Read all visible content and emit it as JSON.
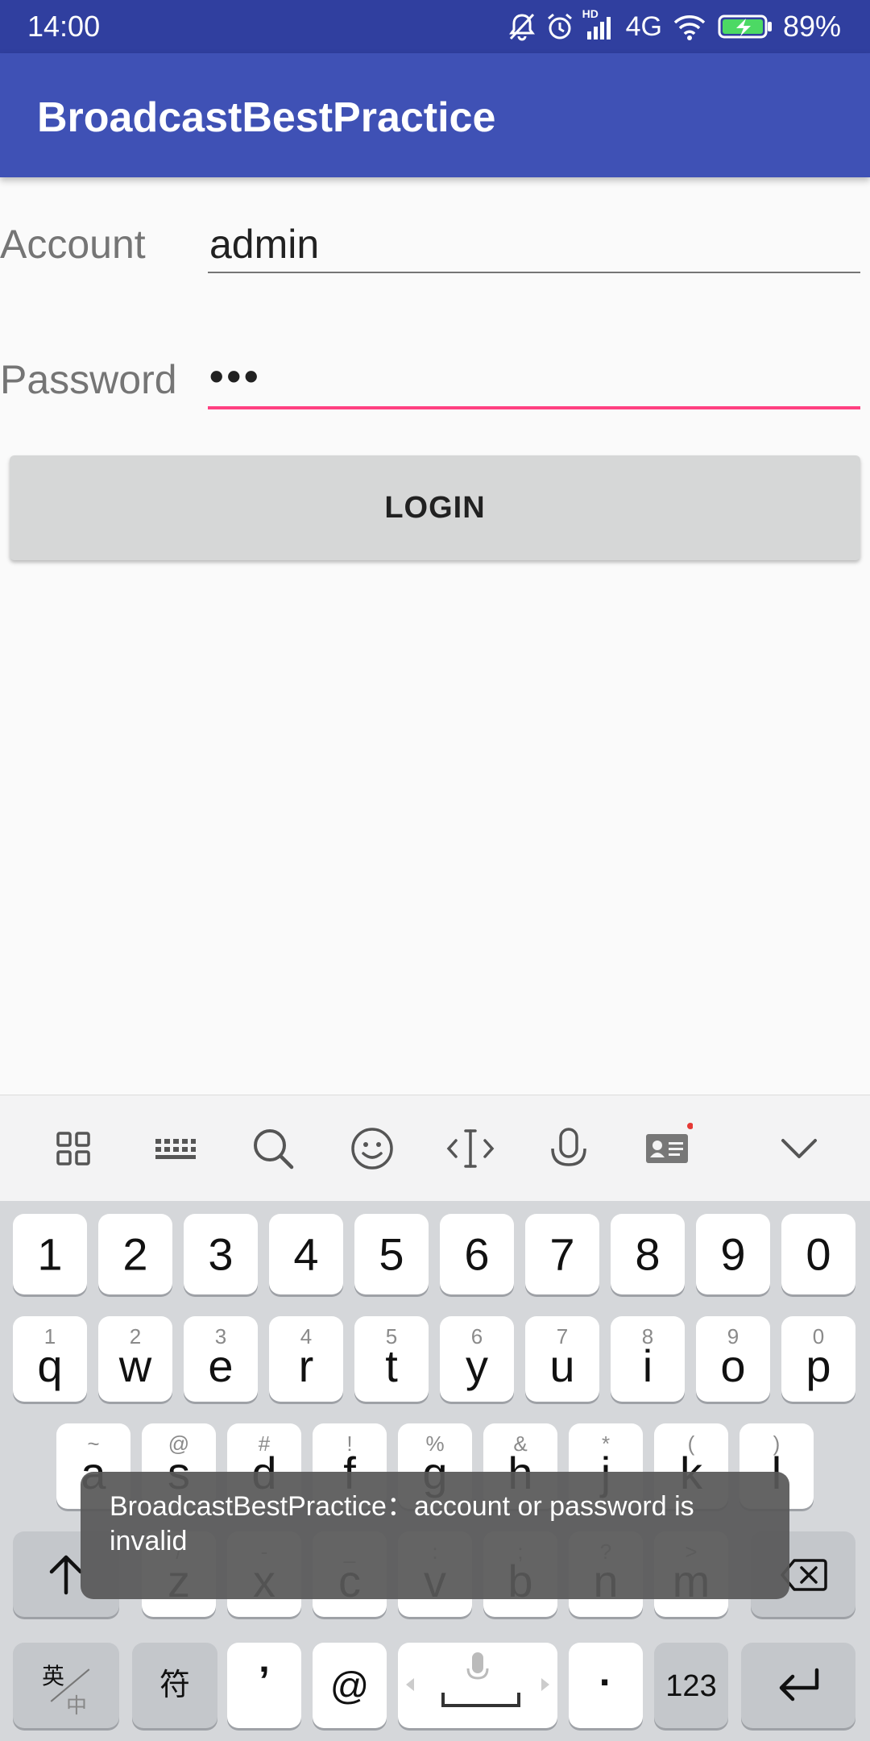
{
  "status": {
    "time": "14:00",
    "network": "4G",
    "hd_label": "HD",
    "battery": "89%",
    "icons": [
      "bell-off-icon",
      "alarm-icon",
      "signal-icon",
      "wifi-icon",
      "battery-charging-icon"
    ]
  },
  "app": {
    "title": "BroadcastBestPractice",
    "colors": {
      "primary": "#3f51b5",
      "primary_dark": "#303f9f",
      "accent": "#ff4081"
    }
  },
  "form": {
    "account_label": "Account",
    "account_value": "admin",
    "password_label": "Password",
    "password_value": "•••",
    "login_label": "LOGIN"
  },
  "keyboard": {
    "toolbar_icons": [
      "grid-icon",
      "keyboard-icon",
      "search-icon",
      "emoji-icon",
      "cursor-icon",
      "microphone-icon",
      "contact-card-icon",
      "collapse-chevron-icon"
    ],
    "number_row": [
      "1",
      "2",
      "3",
      "4",
      "5",
      "6",
      "7",
      "8",
      "9",
      "0"
    ],
    "row1": {
      "keys": [
        "q",
        "w",
        "e",
        "r",
        "t",
        "y",
        "u",
        "i",
        "o",
        "p"
      ],
      "hints": [
        "1",
        "2",
        "3",
        "4",
        "5",
        "6",
        "7",
        "8",
        "9",
        "0"
      ]
    },
    "row2": {
      "keys": [
        "a",
        "s",
        "d",
        "f",
        "g",
        "h",
        "j",
        "k",
        "l"
      ],
      "hints": [
        "~",
        "@",
        "#",
        "!",
        "%",
        "&",
        "*",
        "(",
        ")"
      ]
    },
    "row3": {
      "keys": [
        "z",
        "x",
        "c",
        "v",
        "b",
        "n",
        "m"
      ],
      "hints": [
        "/",
        "-",
        "_",
        ":",
        ";",
        "?",
        ">"
      ]
    },
    "bottom": {
      "lang_top": "英",
      "lang_bottom": "中",
      "symbols": "符",
      "comma": "’",
      "at": "@",
      "period": "·",
      "numbers": "123"
    }
  },
  "toast": {
    "message": "BroadcastBestPractice：account or password is invalid"
  }
}
